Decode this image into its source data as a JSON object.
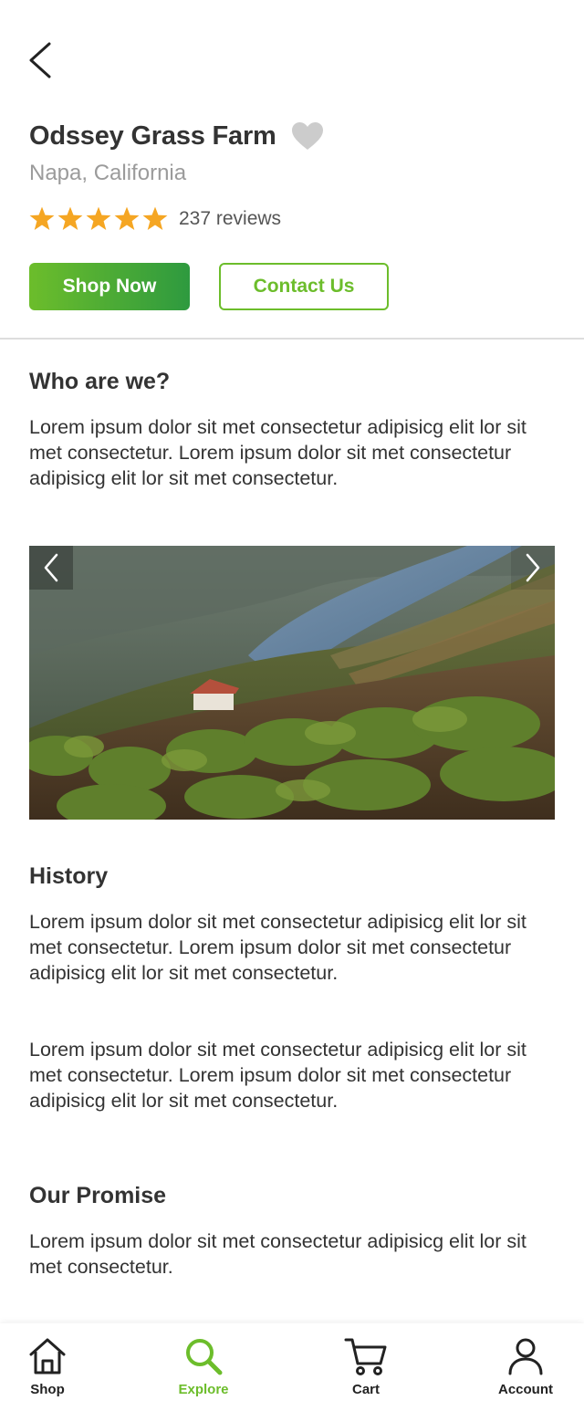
{
  "header": {
    "farm_name": "Odssey Grass Farm",
    "location": "Napa, California",
    "rating": 5,
    "reviews": "237 reviews"
  },
  "actions": {
    "shop_label": "Shop Now",
    "contact_label": "Contact Us"
  },
  "sections": {
    "who": {
      "title": "Who are we?",
      "text": "Lorem ipsum dolor sit met consectetur adipisicg elit lor sit met consectetur. Lorem ipsum dolor sit met consectetur adipisicg elit lor sit met consectetur."
    },
    "history": {
      "title": "History",
      "paragraphs": [
        "Lorem ipsum dolor sit met consectetur adipisicg elit lor sit met consectetur. Lorem ipsum dolor sit met consectetur adipisicg elit lor sit met consectetur.",
        "Lorem ipsum dolor sit met consectetur adipisicg elit lor sit met consectetur. Lorem ipsum dolor sit met consectetur adipisicg elit lor sit met consectetur."
      ]
    },
    "promise": {
      "title": "Our Promise",
      "text": "Lorem ipsum dolor sit met consectetur adipisicg elit lor sit met consectetur."
    }
  },
  "icons": {
    "back": "chevron-left-icon",
    "favorite": "heart-icon",
    "star": "star-icon",
    "carousel_prev": "chevron-left-icon",
    "carousel_next": "chevron-right-icon"
  },
  "tabbar": {
    "items": [
      {
        "label": "Shop",
        "icon": "home-icon",
        "active": false
      },
      {
        "label": "Explore",
        "icon": "search-icon",
        "active": true
      },
      {
        "label": "Cart",
        "icon": "cart-icon",
        "active": false
      },
      {
        "label": "Account",
        "icon": "user-icon",
        "active": false
      }
    ]
  },
  "colors": {
    "accent": "#6cbd2b",
    "accent_dark": "#2e9a3f",
    "star": "#f5a623",
    "heart": "#cccccc",
    "muted_text": "#9b9b9b"
  }
}
